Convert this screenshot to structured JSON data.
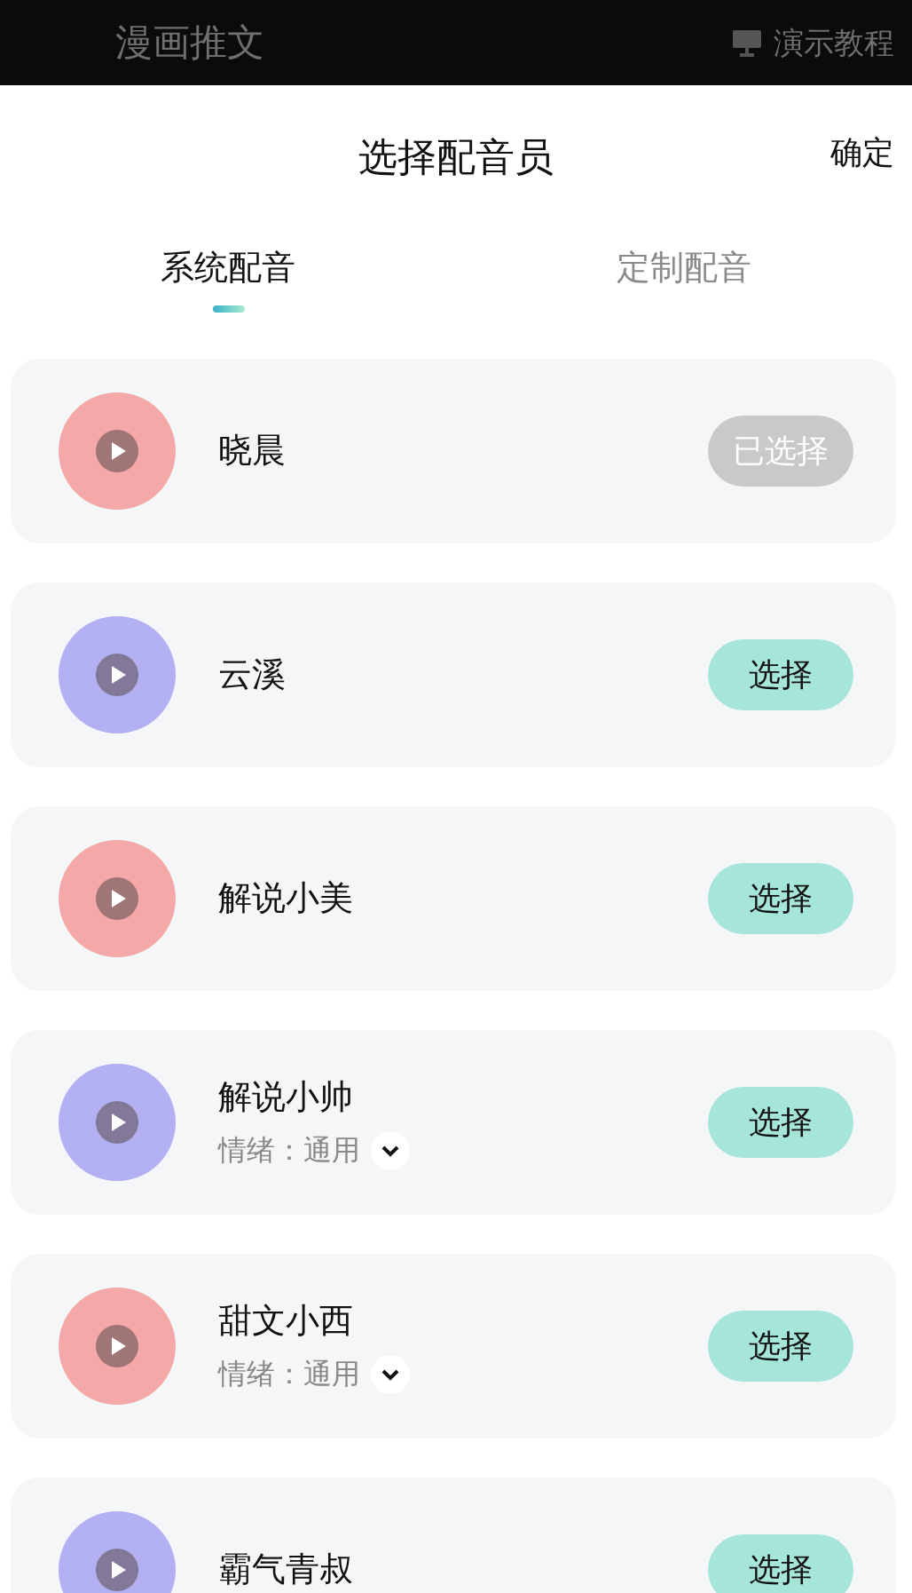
{
  "background_bar": {
    "title": "漫画推文",
    "tutorial": "演示教程"
  },
  "sheet": {
    "title": "选择配音员",
    "confirm": "确定"
  },
  "tabs": [
    {
      "label": "系统配音",
      "selected": true
    },
    {
      "label": "定制配音",
      "selected": false
    }
  ],
  "voices": [
    {
      "name": "晓晨",
      "color": "#f4a9a8",
      "button": "已选择",
      "selected": true
    },
    {
      "name": "云溪",
      "color": "#b3b0f4",
      "button": "选择",
      "selected": false
    },
    {
      "name": "解说小美",
      "color": "#f4a9a8",
      "button": "选择",
      "selected": false
    },
    {
      "name": "解说小帅",
      "color": "#b3b0f4",
      "button": "选择",
      "selected": false,
      "emotion": {
        "label": "情绪：",
        "value": "通用"
      }
    },
    {
      "name": "甜文小西",
      "color": "#f4a9a8",
      "button": "选择",
      "selected": false,
      "emotion": {
        "label": "情绪：",
        "value": "通用"
      }
    },
    {
      "name": "霸气青叔",
      "color": "#b3b0f4",
      "button": "选择",
      "selected": false
    }
  ]
}
